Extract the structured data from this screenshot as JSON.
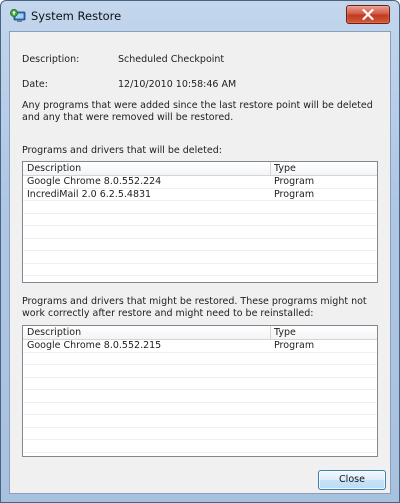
{
  "window": {
    "title": "System Restore",
    "close_icon": "close-x-icon",
    "app_icon": "system-restore-icon"
  },
  "info": {
    "description_label": "Description:",
    "description_value": "Scheduled Checkpoint",
    "date_label": "Date:",
    "date_value": "12/10/2010 10:58:46 AM",
    "note": "Any programs that were added since the last restore point will be deleted and any that were removed will be restored."
  },
  "deleted_section": {
    "heading": "Programs and drivers that will be deleted:",
    "columns": [
      "Description",
      "Type"
    ],
    "rows": [
      {
        "description": "Google Chrome 8.0.552.224",
        "type": "Program"
      },
      {
        "description": "IncrediMail 2.0 6.2.5.4831",
        "type": "Program"
      }
    ]
  },
  "restored_section": {
    "heading": "Programs and drivers that might be restored. These programs might not work correctly after restore and might need to be reinstalled:",
    "columns": [
      "Description",
      "Type"
    ],
    "rows": [
      {
        "description": "Google Chrome 8.0.552.215",
        "type": "Program"
      }
    ]
  },
  "footer": {
    "close_label": "Close"
  },
  "colors": {
    "close_button_red": "#c03a20",
    "button_border_blue": "#3c7fb1"
  }
}
